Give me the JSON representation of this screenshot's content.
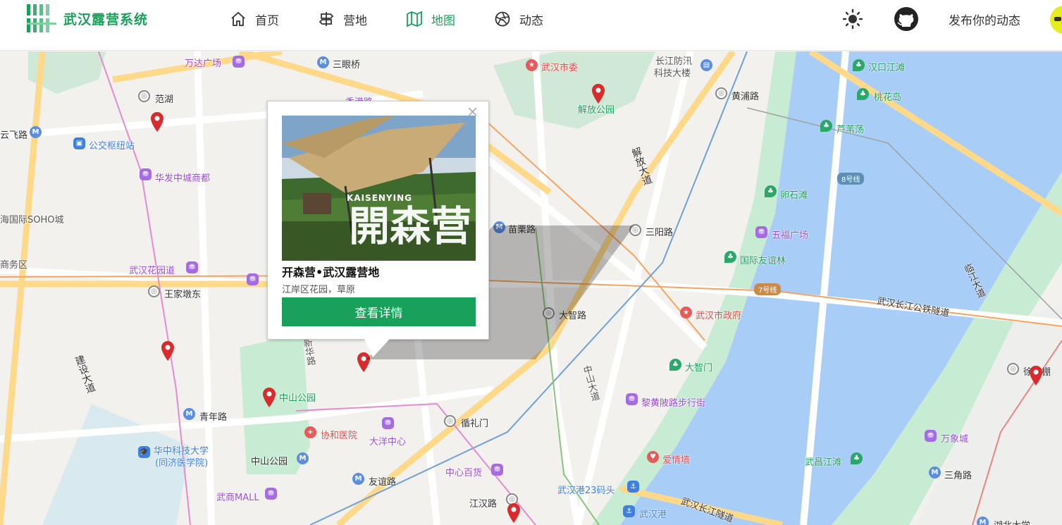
{
  "app": {
    "title": "武汉露营系统"
  },
  "nav": {
    "items": [
      {
        "label": "首页",
        "icon": "home-icon"
      },
      {
        "label": "营地",
        "icon": "signpost-icon"
      },
      {
        "label": "地图",
        "icon": "map-icon",
        "active": true
      },
      {
        "label": "动态",
        "icon": "camera-shutter-icon"
      }
    ]
  },
  "header": {
    "publish_label": "发布你的动态",
    "theme_icon": "sun-icon",
    "github_icon": "github-icon"
  },
  "colors": {
    "accent": "#19a05a",
    "pin": "#d92b2b",
    "water": "#a8cdf7",
    "park": "#c8ecd3"
  },
  "map": {
    "labels": {
      "wanda": "万达广场",
      "sanyanqiao": "三眼桥",
      "wuhanshiwei": "武汉市委",
      "changjiang": "长江防汛",
      "changjiang2": "科技大楼",
      "hankou": "汉口江滩",
      "fanhu": "范湖",
      "taohuadao": "桃花岛",
      "jiefangpark": "解放公园",
      "huangpu": "黄浦路",
      "yunfei": "云飞路",
      "gongjiao": "公交枢纽站",
      "luweidang": "芦苇荡",
      "xianggang": "香港路",
      "huafa": "华发中城商都",
      "jiefangdadao": "解放大道",
      "line8": "8号线",
      "luanshi": "卵石滩",
      "soho": "海国际SOHO城",
      "miaoli": "苗栗路",
      "sanyang": "三阳路",
      "wufu": "五福广场",
      "shangwu": "商务区",
      "youyilin": "国际友谊林",
      "huayuan": "武汉花园道",
      "wangjiadun": "王家墩东",
      "line7": "7号线",
      "linjiang": "临江大道",
      "tunnel1": "武汉长江公铁隧道",
      "dazhi": "大智路",
      "zhengfu": "武汉市政府",
      "jianshe": "建设大道",
      "xinhua": "新华路",
      "dazhimen": "大智门",
      "zhongshan": "中山大道",
      "zhongshanpark": "中山公园",
      "xujiapeng": "徐家棚",
      "liyuan": "黎黄陂路步行街",
      "qingnian": "青年路",
      "xiehe": "协和医院",
      "dayang": "大洋中心",
      "xunlimen": "循礼门",
      "wanxiang": "万象城",
      "huazhong1": "华中科技大学",
      "huazhong2": "(同济医学院)",
      "aiqing": "爱情墙",
      "zhongshanpark2": "中山公园",
      "zhongxin": "中心百货",
      "wuchang": "武昌江滩",
      "sanjiao": "三角路",
      "youyi": "友谊路",
      "wushang": "武商MALL",
      "wuhangang23": "武汉港23码头",
      "jianghan": "江汉路",
      "wuhangang": "武汉港",
      "tunnel2": "武汉长江隧道",
      "hubeida": "湖北大学"
    }
  },
  "popup": {
    "title": "开森营•武汉露营地",
    "subtitle": "江岸区花园，草原",
    "button": "查看详情",
    "close": "×",
    "image_caption": "KAISENYING",
    "image_big": "開森营"
  }
}
